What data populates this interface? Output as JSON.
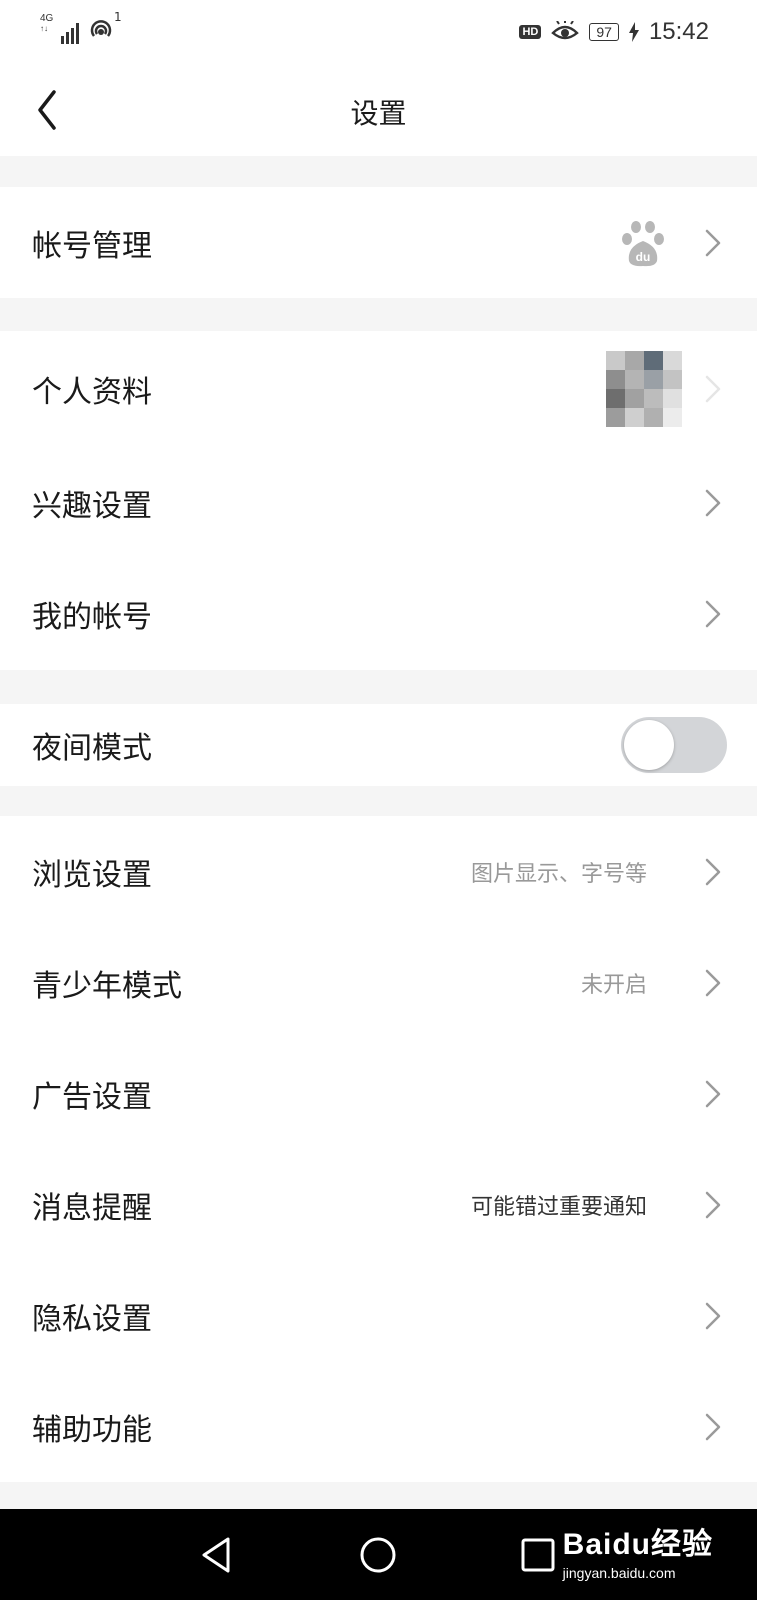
{
  "status_bar": {
    "network": "4G",
    "hotspot_count": "1",
    "hd_badge": "HD",
    "battery": "97",
    "time": "15:42"
  },
  "header": {
    "title": "设置"
  },
  "sections": {
    "account": {
      "label": "帐号管理"
    },
    "profile": {
      "label": "个人资料"
    },
    "interest": {
      "label": "兴趣设置"
    },
    "my_account": {
      "label": "我的帐号"
    },
    "night_mode": {
      "label": "夜间模式",
      "enabled": false
    },
    "browse": {
      "label": "浏览设置",
      "hint": "图片显示、字号等"
    },
    "youth": {
      "label": "青少年模式",
      "hint": "未开启"
    },
    "ads": {
      "label": "广告设置"
    },
    "notifications": {
      "label": "消息提醒",
      "hint": "可能错过重要通知"
    },
    "privacy": {
      "label": "隐私设置"
    },
    "accessibility": {
      "label": "辅助功能"
    }
  },
  "watermark": {
    "brand": "Baidu经验",
    "url": "jingyan.baidu.com"
  },
  "colors": {
    "background": "#ffffff",
    "section_gap": "#f5f5f5",
    "text_primary": "#1a1a1a",
    "text_secondary": "#999999",
    "toggle_off": "#d3d5d8",
    "nav_bar": "#000000"
  }
}
